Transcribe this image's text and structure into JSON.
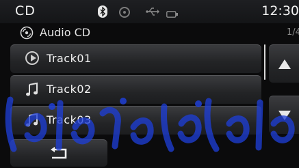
{
  "status_bar": {
    "source": "CD",
    "time": "12:30",
    "icons": [
      "bluetooth-icon",
      "disc-icon",
      "usb-icon",
      "battery-icon"
    ]
  },
  "header": {
    "title": "Audio CD",
    "page_indicator": "1/4",
    "icon": "cd-icon"
  },
  "tracks": [
    {
      "label": "Track01",
      "icon": "play-icon",
      "state": "playing"
    },
    {
      "label": "Track02",
      "icon": "music-note-icon"
    },
    {
      "label": "Track03",
      "icon": "music-note-icon"
    }
  ],
  "scroll": {
    "up_icon": "arrow-up-icon",
    "down_icon": "arrow-down-icon"
  },
  "back_button": {
    "icon": "back-arrow-icon"
  },
  "colors": {
    "background": "#0b0b0c",
    "button_top": "#3a3b3e",
    "button_bottom": "#1c1d1f",
    "watermark": "#1f3fd6"
  }
}
